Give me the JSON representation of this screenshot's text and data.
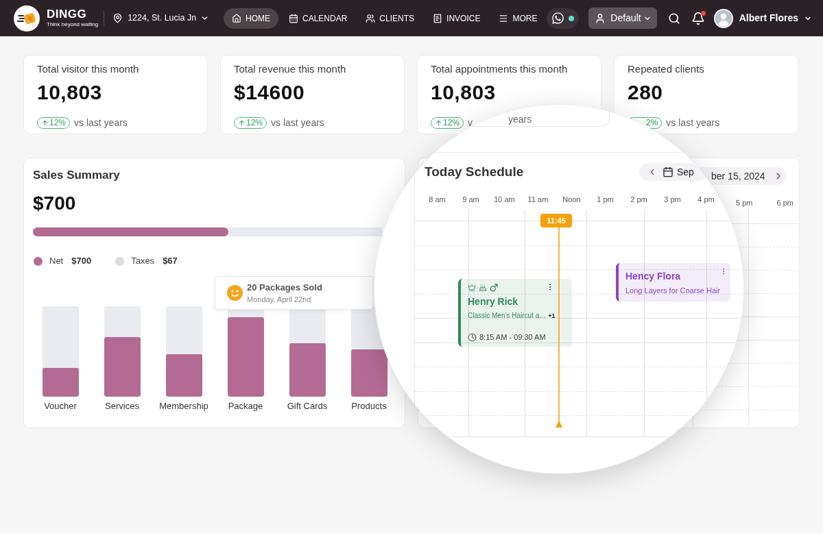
{
  "nav": {
    "logo": {
      "name": "DINGG",
      "tagline": "Think beyond waiting"
    },
    "location": "1224, St. Lucia Jn",
    "items": [
      {
        "label": "HOME",
        "selected": true
      },
      {
        "label": "CALENDAR",
        "selected": false
      },
      {
        "label": "CLIENTS",
        "selected": false
      },
      {
        "label": "INVOICE",
        "selected": false
      },
      {
        "label": "MORE",
        "selected": false
      }
    ],
    "chat": {
      "connected": true
    },
    "profile": "Default",
    "notifications": {
      "unread": true
    },
    "user": "Albert Flores"
  },
  "stats": [
    {
      "kind": "rising",
      "title": "Total visitor this month",
      "value": "10,803",
      "change": "12%",
      "note": "vs last years"
    },
    {
      "kind": "rising",
      "title": "Total revenue this month",
      "value": "$14600",
      "change": "12%",
      "note": "vs last years"
    },
    {
      "kind": "rising",
      "title": "Total appointments this month",
      "value": "10,803",
      "change": "12%",
      "note": "v"
    },
    {
      "kind": "covered",
      "title": "Repeated clients",
      "value": "280",
      "change": "2%",
      "note": "vs last years"
    }
  ],
  "sales_summary": {
    "title": "Sales Summary",
    "total": "$700",
    "level": 0.56,
    "legend": [
      {
        "label": "Net",
        "value": "$700",
        "color": "#b36b94"
      },
      {
        "label": "Taxes",
        "value": "$67",
        "color": "#dcdcdc"
      }
    ],
    "tooltip": {
      "title": "20 Packages Sold",
      "date": "Monday, April 22nd"
    },
    "bars": [
      {
        "label": "Voucher",
        "level": 0.32
      },
      {
        "label": "Services",
        "level": 0.66
      },
      {
        "label": "Membership",
        "level": 0.47
      },
      {
        "label": "Package",
        "level": 0.88
      },
      {
        "label": "Gift Cards",
        "level": 0.59
      },
      {
        "label": "Products",
        "level": 0.52
      }
    ]
  },
  "schedule": {
    "date": "ber 15, 2024",
    "hours": [
      "5 pm",
      "6 pm"
    ]
  },
  "magnifier": {
    "stat_note": "years",
    "schedule": {
      "title": "Today Schedule",
      "date": "Sep",
      "hours": [
        "8 am",
        "9 am",
        "10 am",
        "11 am",
        "Noon",
        "1 pm",
        "2 pm",
        "3 pm",
        "4 pm"
      ],
      "now": "11:45",
      "events": [
        {
          "kind": "detailed",
          "name": "Henry Rick",
          "service": "Classic Men’s Haircut a…",
          "extra": "+1",
          "time": "8:15 AM - 09:30 AM",
          "color": "#2f8a5a"
        },
        {
          "kind": "compact",
          "name": "Hency Flora",
          "service": "Long Layers for Coarse Hair",
          "color": "#8e44c4"
        }
      ]
    }
  }
}
